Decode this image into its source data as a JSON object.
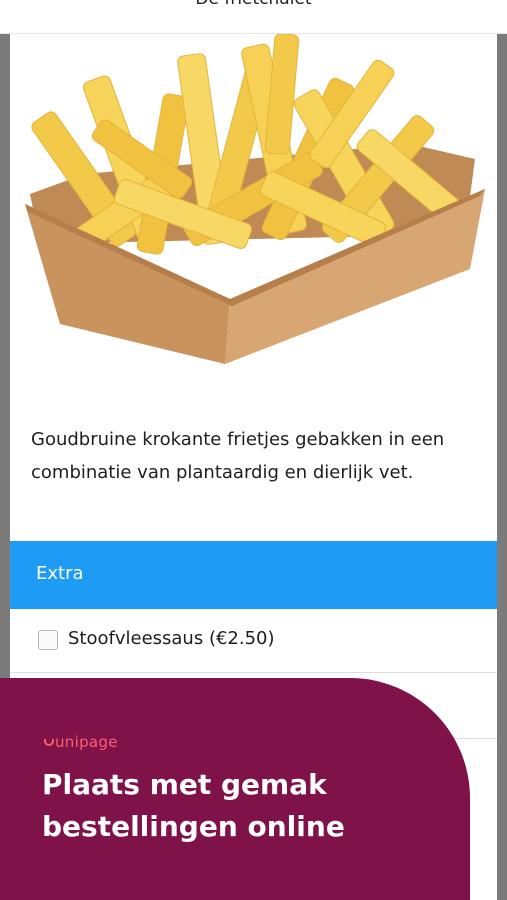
{
  "header": {
    "title": "De frietchalet"
  },
  "product": {
    "image_icon": "fries-in-paper-tray",
    "description": "Goudbruine krokante frietjes gebakken in een combinatie van plantaardig en dierlijk vet."
  },
  "extras": {
    "title": "Extra",
    "options": [
      {
        "label": "Stoofvleessaus (€2.50)",
        "checked": false
      }
    ]
  },
  "promo": {
    "brand": "unipage",
    "heading_line1": "Plaats met gemak",
    "heading_line2": "bestellingen online"
  },
  "colors": {
    "section_header": "#1e9bf5",
    "promo_background": "#7e1249",
    "promo_brand": "#ff5f6d"
  }
}
